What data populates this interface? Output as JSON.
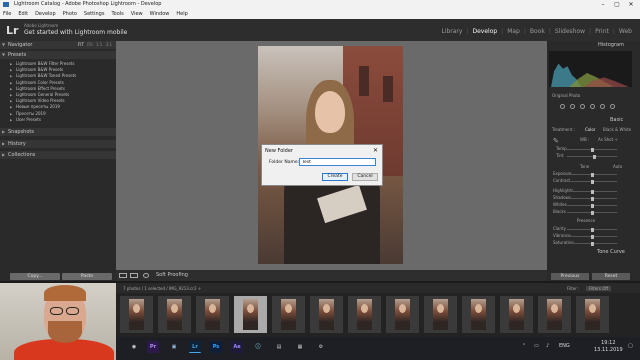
{
  "window": {
    "title": "Lightroom Catalog - Adobe Photoshop Lightroom - Develop",
    "minimize": "–",
    "maximize": "▢",
    "close": "✕"
  },
  "menu": [
    "File",
    "Edit",
    "Develop",
    "Photo",
    "Settings",
    "Tools",
    "View",
    "Window",
    "Help"
  ],
  "identity": {
    "logo": "Lr",
    "catalog": "Adobe Lightroom",
    "mobile": "Get started with Lightroom mobile"
  },
  "modules": [
    "Library",
    "Develop",
    "Map",
    "Book",
    "Slideshow",
    "Print",
    "Web"
  ],
  "active_module": "Develop",
  "left_panel": {
    "navigator": "Navigator",
    "nav_options": [
      "FIT",
      "Fill",
      "1:1",
      "3:1"
    ],
    "presets_header": "Presets",
    "presets": [
      "Lightroom B&W Filter Presets",
      "Lightroom B&W Presets",
      "Lightroom B&W Toned Presets",
      "Lightroom Color Presets",
      "Lightroom Effect Presets",
      "Lightroom General Presets",
      "Lightroom Video Presets",
      "Новые пресеты 2019",
      "Пресеты 2019",
      "User Presets"
    ],
    "snapshots": "Snapshots",
    "history": "History",
    "collections": "Collections",
    "copy_button": "Copy...",
    "paste_button": "Paste"
  },
  "toolbar": {
    "soft_proofing": "Soft Proofing"
  },
  "dialog": {
    "title": "New Folder",
    "close": "✕",
    "label": "Folder Name:",
    "value": "Test",
    "create": "Create",
    "cancel": "Cancel"
  },
  "right_panel": {
    "histogram": "Histogram",
    "original_photo": "Original Photo",
    "basic": "Basic",
    "treatment": "Treatment :",
    "color": "Color",
    "bw": "Black & White",
    "wb": "WB :",
    "as_shot": "As Shot ÷",
    "temp": "Temp",
    "tint": "Tint",
    "tone": "Tone",
    "auto": "Auto",
    "exposure": "Exposure",
    "contrast": "Contrast",
    "highlights": "Highlights",
    "shadows": "Shadows",
    "whites": "Whites",
    "blacks": "Blacks",
    "presence": "Presence",
    "clarity": "Clarity",
    "vibrance": "Vibrance",
    "saturation": "Saturation",
    "tone_curve": "Tone Curve",
    "previous": "Previous",
    "reset": "Reset"
  },
  "filmstrip": {
    "info": "7 photos / 1 selected / IMG_9213.cr2 ÷",
    "filter": "Filter :",
    "filter_value": "Filters Off",
    "thumb_count": 13,
    "selected_index": 3
  },
  "taskbar": {
    "apps": [
      {
        "label": "Pr",
        "color": "#2b1a4a",
        "fg": "#b48cff"
      },
      {
        "label": "Ps",
        "color": "#0f1f3a",
        "fg": "#31a8ff"
      },
      {
        "label": "Lr",
        "color": "#0e2338",
        "fg": "#4aa8e8"
      },
      {
        "label": "Ps",
        "color": "#0f1f3a",
        "fg": "#31a8ff"
      },
      {
        "label": "Ae",
        "color": "#1f1a3a",
        "fg": "#9a88ff"
      }
    ],
    "lang": "ENG",
    "time": "19:12",
    "date": "13.11.2019"
  }
}
